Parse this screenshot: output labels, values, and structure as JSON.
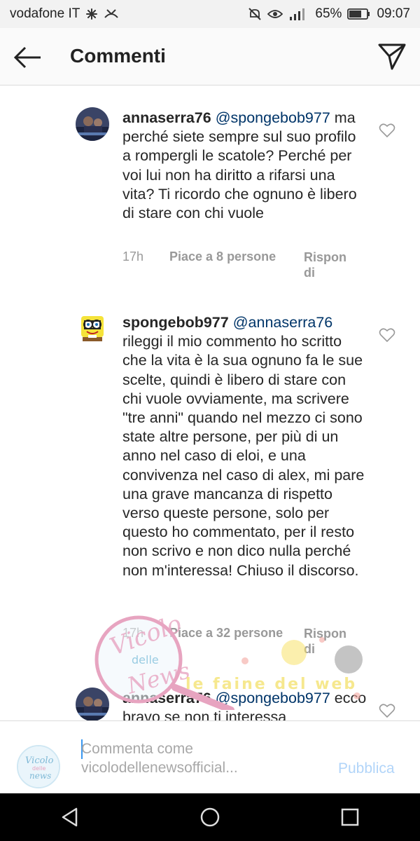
{
  "status_bar": {
    "carrier": "vodafone IT",
    "battery_percent": "65%",
    "time": "09:07",
    "icons": [
      "asterisk-icon",
      "missed-call-icon",
      "mute-icon",
      "eye-icon",
      "signal-icon",
      "battery-icon"
    ]
  },
  "header": {
    "title": "Commenti",
    "back_icon": "back-arrow-icon",
    "share_icon": "send-icon"
  },
  "comments": [
    {
      "username": "annaserra76",
      "mention": "@spongebob977",
      "text": "ma perché siete sempre sul suo profilo a rompergli le scatole? Perché per voi lui non ha diritto a rifarsi una vita? Ti ricordo che ognuno è libero di stare con chi vuole",
      "time": "17h",
      "likes": "Piace a 8 persone",
      "reply": "Rispondi"
    },
    {
      "username": "spongebob977",
      "mention": "@annaserra76",
      "text": "rileggi il mio commento ho scritto che la vita è la sua ognuno fa le sue scelte, quindi è libero di stare con chi vuole ovviamente, ma scrivere \"tre anni\" quando nel mezzo ci sono state altre persone, per più di un anno nel caso di eloi, e una convivenza nel caso di alex, mi pare una grave mancanza di rispetto verso queste persone, solo per questo ho commentato, per il resto non scrivo e non dico nulla perché non m'interessa! Chiuso il discorso.",
      "time": "17h",
      "likes": "Piace a 32 persone",
      "reply": "Rispondi"
    },
    {
      "username": "annaserra76",
      "mention": "@spongebob977",
      "text": "ecco bravo se non ti interessa",
      "time": "",
      "likes": "",
      "reply": ""
    }
  ],
  "watermark": {
    "logo_text_1": "Vicolo",
    "logo_text_2": "delle",
    "logo_text_3": "News",
    "tagline": "le faine del web"
  },
  "composer": {
    "placeholder": "Commenta come vicolodellenewsofficial...",
    "publish_label": "Pubblica",
    "avatar_text_1": "Vicolo",
    "avatar_text_2": "delle",
    "avatar_text_3": "news"
  },
  "navigation": {
    "buttons": [
      "back-triangle-icon",
      "home-circle-icon",
      "recents-square-icon"
    ]
  }
}
